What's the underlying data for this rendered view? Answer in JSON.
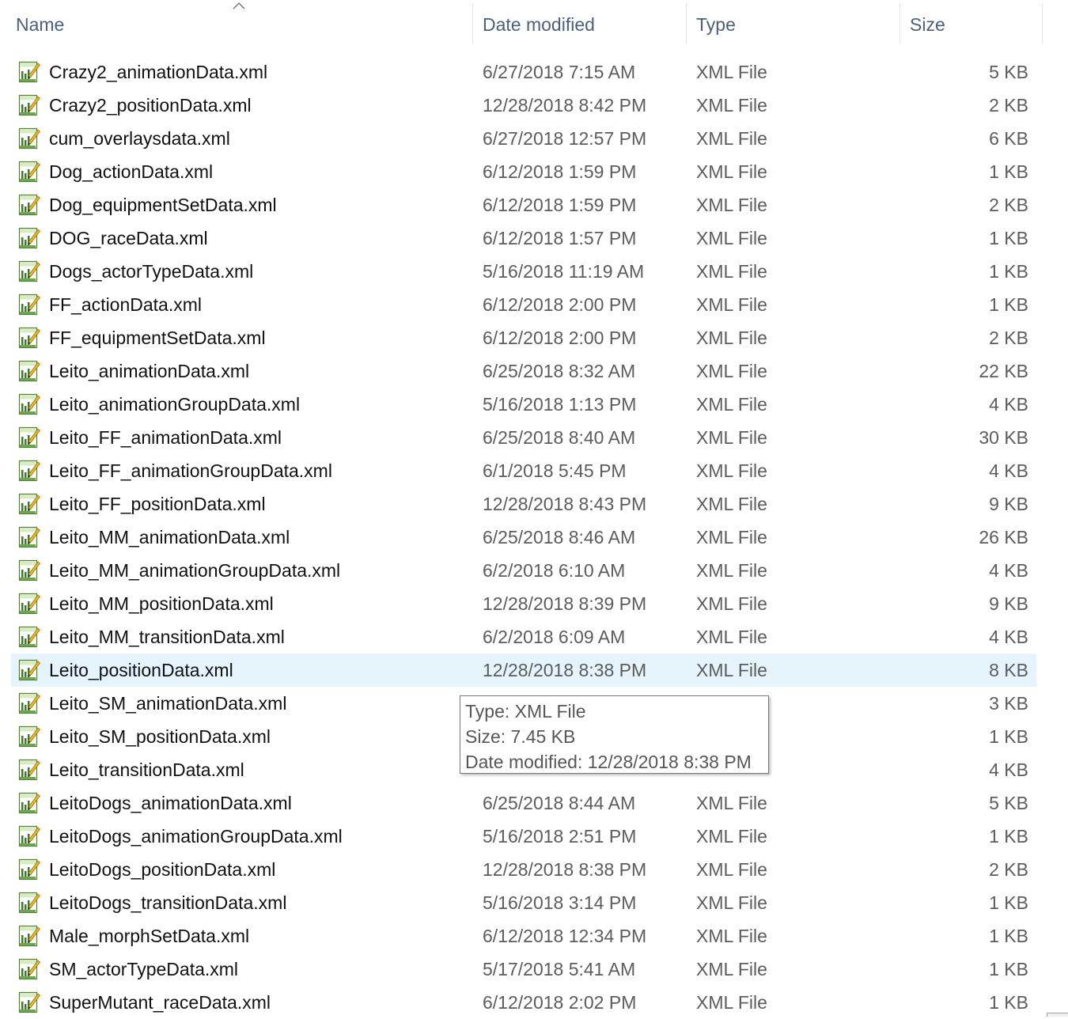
{
  "columns": {
    "name": "Name",
    "date": "Date modified",
    "type": "Type",
    "size": "Size",
    "sort_icon": "chevron-up-icon"
  },
  "file_icon": "xml-file-icon",
  "files": [
    {
      "name": "Crazy2_animationData.xml",
      "date": "6/27/2018 7:15 AM",
      "type": "XML File",
      "size": "5 KB"
    },
    {
      "name": "Crazy2_positionData.xml",
      "date": "12/28/2018 8:42 PM",
      "type": "XML File",
      "size": "2 KB"
    },
    {
      "name": "cum_overlaysdata.xml",
      "date": "6/27/2018 12:57 PM",
      "type": "XML File",
      "size": "6 KB"
    },
    {
      "name": "Dog_actionData.xml",
      "date": "6/12/2018 1:59 PM",
      "type": "XML File",
      "size": "1 KB"
    },
    {
      "name": "Dog_equipmentSetData.xml",
      "date": "6/12/2018 1:59 PM",
      "type": "XML File",
      "size": "2 KB"
    },
    {
      "name": "DOG_raceData.xml",
      "date": "6/12/2018 1:57 PM",
      "type": "XML File",
      "size": "1 KB"
    },
    {
      "name": "Dogs_actorTypeData.xml",
      "date": "5/16/2018 11:19 AM",
      "type": "XML File",
      "size": "1 KB"
    },
    {
      "name": "FF_actionData.xml",
      "date": "6/12/2018 2:00 PM",
      "type": "XML File",
      "size": "1 KB"
    },
    {
      "name": "FF_equipmentSetData.xml",
      "date": "6/12/2018 2:00 PM",
      "type": "XML File",
      "size": "2 KB"
    },
    {
      "name": "Leito_animationData.xml",
      "date": "6/25/2018 8:32 AM",
      "type": "XML File",
      "size": "22 KB"
    },
    {
      "name": "Leito_animationGroupData.xml",
      "date": "5/16/2018 1:13 PM",
      "type": "XML File",
      "size": "4 KB"
    },
    {
      "name": "Leito_FF_animationData.xml",
      "date": "6/25/2018 8:40 AM",
      "type": "XML File",
      "size": "30 KB"
    },
    {
      "name": "Leito_FF_animationGroupData.xml",
      "date": "6/1/2018 5:45 PM",
      "type": "XML File",
      "size": "4 KB"
    },
    {
      "name": "Leito_FF_positionData.xml",
      "date": "12/28/2018 8:43 PM",
      "type": "XML File",
      "size": "9 KB"
    },
    {
      "name": "Leito_MM_animationData.xml",
      "date": "6/25/2018 8:46 AM",
      "type": "XML File",
      "size": "26 KB"
    },
    {
      "name": "Leito_MM_animationGroupData.xml",
      "date": "6/2/2018 6:10 AM",
      "type": "XML File",
      "size": "4 KB"
    },
    {
      "name": "Leito_MM_positionData.xml",
      "date": "12/28/2018 8:39 PM",
      "type": "XML File",
      "size": "9 KB"
    },
    {
      "name": "Leito_MM_transitionData.xml",
      "date": "6/2/2018 6:09 AM",
      "type": "XML File",
      "size": "4 KB"
    },
    {
      "name": "Leito_positionData.xml",
      "date": "12/28/2018 8:38 PM",
      "type": "XML File",
      "size": "8 KB",
      "hovered": true
    },
    {
      "name": "Leito_SM_animationData.xml",
      "date": "",
      "type": "",
      "size": "3 KB"
    },
    {
      "name": "Leito_SM_positionData.xml",
      "date": "",
      "type": "",
      "size": "1 KB"
    },
    {
      "name": "Leito_transitionData.xml",
      "date": "",
      "type": "",
      "size": "4 KB"
    },
    {
      "name": "LeitoDogs_animationData.xml",
      "date": "6/25/2018 8:44 AM",
      "type": "XML File",
      "size": "5 KB"
    },
    {
      "name": "LeitoDogs_animationGroupData.xml",
      "date": "5/16/2018 2:51 PM",
      "type": "XML File",
      "size": "1 KB"
    },
    {
      "name": "LeitoDogs_positionData.xml",
      "date": "12/28/2018 8:38 PM",
      "type": "XML File",
      "size": "2 KB"
    },
    {
      "name": "LeitoDogs_transitionData.xml",
      "date": "5/16/2018 3:14 PM",
      "type": "XML File",
      "size": "1 KB"
    },
    {
      "name": "Male_morphSetData.xml",
      "date": "6/12/2018 12:34 PM",
      "type": "XML File",
      "size": "1 KB"
    },
    {
      "name": "SM_actorTypeData.xml",
      "date": "5/17/2018 5:41 AM",
      "type": "XML File",
      "size": "1 KB"
    },
    {
      "name": "SuperMutant_raceData.xml",
      "date": "6/12/2018 2:02 PM",
      "type": "XML File",
      "size": "1 KB"
    }
  ],
  "tooltip": {
    "type_line": "Type: XML File",
    "size_line": "Size: 7.45 KB",
    "date_line": "Date modified: 12/28/2018 8:38 PM"
  },
  "colors": {
    "header_text": "#4c607a",
    "hover_row": "#e5f3fb",
    "secondary_text": "#5c5c5c"
  }
}
